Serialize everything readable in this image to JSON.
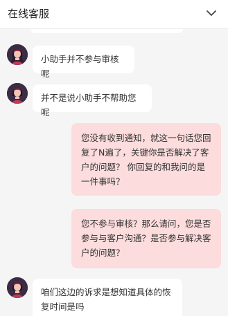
{
  "header": {
    "title": "在线客服"
  },
  "icons": {
    "collapse": "chevron-down-icon",
    "agent_avatar": "agent-avatar-icon"
  },
  "colors": {
    "incoming_bubble": "#ffffff",
    "outgoing_bubble": "#fcdcdc",
    "background": "#f5f5f5"
  },
  "messages": [
    {
      "sender": "agent",
      "text": "小助手并不参与审核呢"
    },
    {
      "sender": "agent",
      "text": "并不是说小助手不帮助您呢"
    },
    {
      "sender": "user",
      "text": "您没有收到通知，就这一句话您回复了N遍了，关键你是否解决了客户的问题？ 你回复的和我问的是一件事吗？"
    },
    {
      "sender": "user",
      "text": "您不参与审核？那么请问，您是否参与与客户沟通？是否参与解决客户的问题？"
    },
    {
      "sender": "agent",
      "text": "咱们这边的诉求是想知道具体的恢复时间是吗"
    }
  ]
}
